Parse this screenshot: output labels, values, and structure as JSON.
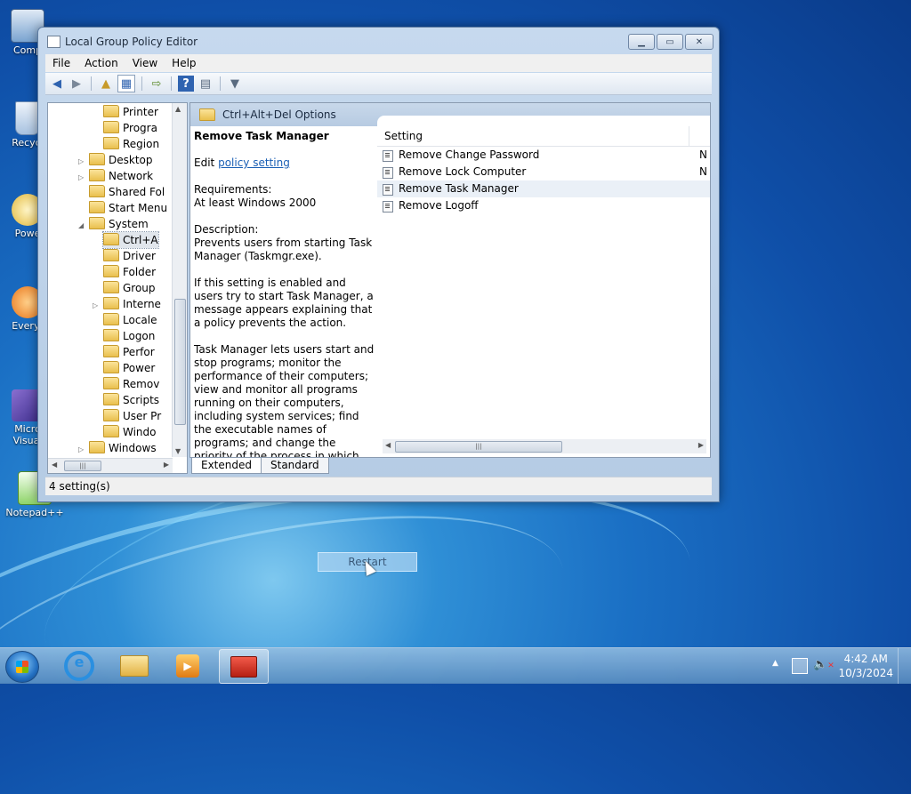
{
  "desktop": {
    "icons": [
      {
        "label": "Comp"
      },
      {
        "label": "Recycl"
      },
      {
        "label": "Powe"
      },
      {
        "label": "Everyt"
      },
      {
        "label": "Micro Visual"
      },
      {
        "label": "Notepad++"
      }
    ]
  },
  "window": {
    "title": "Local Group Policy Editor",
    "menu": [
      "File",
      "Action",
      "View",
      "Help"
    ],
    "tree": [
      {
        "label": "Printer",
        "indent": 2,
        "expander": ""
      },
      {
        "label": "Progra",
        "indent": 2,
        "expander": ""
      },
      {
        "label": "Region",
        "indent": 2,
        "expander": ""
      },
      {
        "label": "Desktop",
        "indent": 1,
        "expander": "collapsed"
      },
      {
        "label": "Network",
        "indent": 1,
        "expander": "collapsed"
      },
      {
        "label": "Shared Fol",
        "indent": 1,
        "expander": ""
      },
      {
        "label": "Start Menu",
        "indent": 1,
        "expander": ""
      },
      {
        "label": "System",
        "indent": 1,
        "expander": "expanded"
      },
      {
        "label": "Ctrl+A",
        "indent": 2,
        "expander": "",
        "selected": true
      },
      {
        "label": "Driver",
        "indent": 2,
        "expander": ""
      },
      {
        "label": "Folder",
        "indent": 2,
        "expander": ""
      },
      {
        "label": "Group",
        "indent": 2,
        "expander": ""
      },
      {
        "label": "Interne",
        "indent": 2,
        "expander": "collapsed"
      },
      {
        "label": "Locale",
        "indent": 2,
        "expander": ""
      },
      {
        "label": "Logon",
        "indent": 2,
        "expander": ""
      },
      {
        "label": "Perfor",
        "indent": 2,
        "expander": ""
      },
      {
        "label": "Power",
        "indent": 2,
        "expander": ""
      },
      {
        "label": "Remov",
        "indent": 2,
        "expander": ""
      },
      {
        "label": "Scripts",
        "indent": 2,
        "expander": ""
      },
      {
        "label": "User Pr",
        "indent": 2,
        "expander": ""
      },
      {
        "label": "Windo",
        "indent": 2,
        "expander": ""
      },
      {
        "label": "Windows",
        "indent": 1,
        "expander": "collapsed"
      }
    ],
    "pane_header": "Ctrl+Alt+Del Options",
    "detail": {
      "title": "Remove Task Manager",
      "edit_prefix": "Edit",
      "edit_link": "policy setting",
      "requirements_label": "Requirements:",
      "requirements_value": "At least Windows 2000",
      "description_label": "Description:",
      "description_1": "Prevents users from starting Task Manager (Taskmgr.exe).",
      "description_2": "If this setting is enabled and users try to start Task Manager, a message appears explaining that a policy prevents the action.",
      "description_3": "Task Manager lets users start and stop programs; monitor the performance of their computers; view and monitor all programs running on their computers, including system services; find the executable names of programs; and change the priority of the process in which programs run."
    },
    "list": {
      "column_setting": "Setting",
      "rows": [
        {
          "name": "Remove Change Password",
          "state": "N"
        },
        {
          "name": "Remove Lock Computer",
          "state": "N"
        },
        {
          "name": "Remove Task Manager",
          "state": "",
          "selected": true
        },
        {
          "name": "Remove Logoff",
          "state": ""
        }
      ]
    },
    "tabs": [
      "Extended",
      "Standard"
    ],
    "status": "4 setting(s)"
  },
  "popup": {
    "label": "Restart"
  },
  "taskbar": {
    "time": "4:42 AM",
    "date": "10/3/2024"
  }
}
